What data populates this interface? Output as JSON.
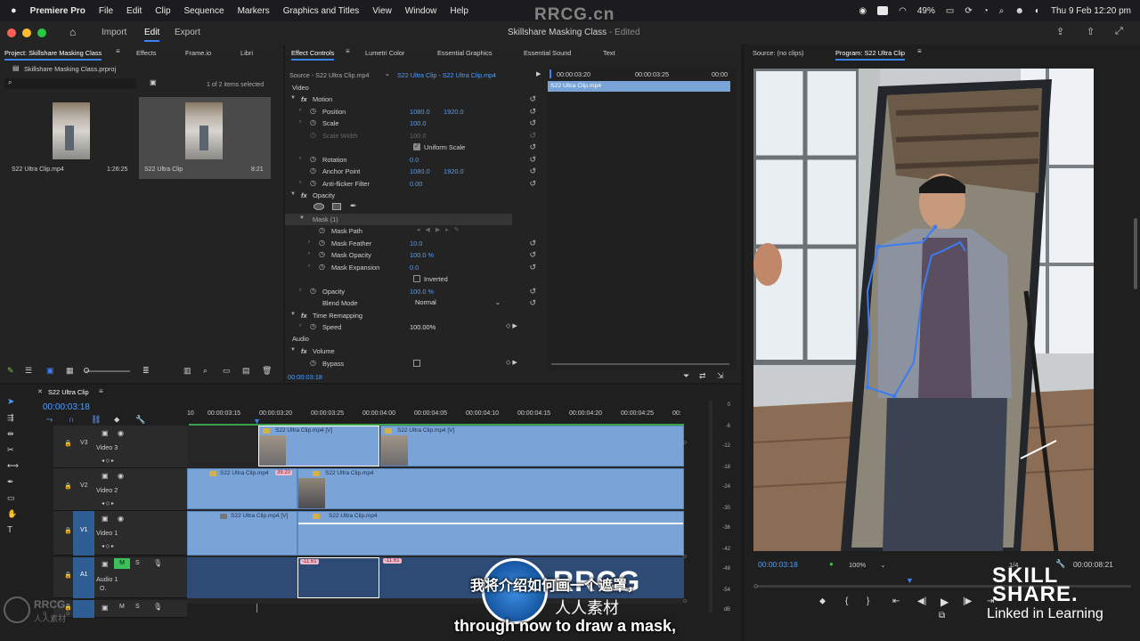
{
  "menubar": {
    "items": [
      "Premiere Pro",
      "File",
      "Edit",
      "Clip",
      "Sequence",
      "Markers",
      "Graphics and Titles",
      "View",
      "Window",
      "Help"
    ],
    "battery": "49%",
    "datetime": "Thu 9 Feb  12:20 pm"
  },
  "watermark": {
    "top": "RRCG.cn"
  },
  "titlebar": {
    "workspaces": [
      "Import",
      "Edit",
      "Export"
    ],
    "document_title": "Skillshare Masking Class",
    "status": "- Edited"
  },
  "project": {
    "tabs": [
      "Project: Skillshare Masking Class",
      "Effects",
      "Frame.io",
      "Libri"
    ],
    "file": "Skillshare Masking Class.prproj",
    "selection_info": "1 of 2 items selected",
    "items": [
      {
        "name": "S22 Ultra Clip.mp4",
        "duration": "1:26:25"
      },
      {
        "name": "S22 Ultra Clip",
        "duration": "8:21"
      }
    ]
  },
  "effect_controls": {
    "tabs": [
      "Effect Controls",
      "Lumetri Color",
      "Essential Graphics",
      "Essential Sound",
      "Text"
    ],
    "source_label": "Source - S22 Ultra Clip.mp4",
    "sequence_clip": "S22 Ultra Clip - S22 Ultra Clip.mp4",
    "sections": {
      "video": "Video",
      "audio": "Audio"
    },
    "rows": [
      {
        "label": "Motion",
        "v1": "",
        "v2": ""
      },
      {
        "label": "Position",
        "v1": "1080.0",
        "v2": "1920.0"
      },
      {
        "label": "Scale",
        "v1": "100.0",
        "v2": ""
      },
      {
        "label": "Scale Width",
        "v1": "100.0",
        "v2": ""
      },
      {
        "label": "Uniform Scale",
        "v1": "",
        "v2": ""
      },
      {
        "label": "Rotation",
        "v1": "0.0",
        "v2": ""
      },
      {
        "label": "Anchor Point",
        "v1": "1080.0",
        "v2": "1920.0"
      },
      {
        "label": "Anti-flicker Filter",
        "v1": "0.00",
        "v2": ""
      },
      {
        "label": "Opacity",
        "v1": "",
        "v2": ""
      },
      {
        "label": "Mask (1)",
        "v1": "",
        "v2": ""
      },
      {
        "label": "Mask Path",
        "v1": "",
        "v2": ""
      },
      {
        "label": "Mask Feather",
        "v1": "10.0",
        "v2": ""
      },
      {
        "label": "Mask Opacity",
        "v1": "100.0 %",
        "v2": ""
      },
      {
        "label": "Mask Expansion",
        "v1": "0.0",
        "v2": ""
      },
      {
        "label": "Inverted",
        "v1": "",
        "v2": ""
      },
      {
        "label": "Opacity",
        "v1": "100.0 %",
        "v2": ""
      },
      {
        "label": "Blend Mode",
        "v1": "Normal",
        "v2": ""
      },
      {
        "label": "Time Remapping",
        "v1": "",
        "v2": ""
      },
      {
        "label": "Speed",
        "v1": "100.00%",
        "v2": ""
      },
      {
        "label": "Volume",
        "v1": "",
        "v2": ""
      },
      {
        "label": "Bypass",
        "v1": "",
        "v2": ""
      }
    ],
    "timeline_times": [
      "00:00:03:20",
      "00:00:03:25",
      "00:00"
    ],
    "timeline_clip": "S22 Ultra Clip.mp4",
    "current_time": "00:00:03:18"
  },
  "program": {
    "source_tab": "Source: (no clips)",
    "program_tab": "Program: S22 Ultra Clip",
    "timecode": "00:00:03:18",
    "zoom": "100%",
    "quality": "1/4",
    "duration": "00:00:08:21"
  },
  "timeline": {
    "sequence_name": "S22 Ultra Clip",
    "timecode": "00:00:03:18",
    "ruler": [
      "10",
      "00:00:03:15",
      "00:00:03:20",
      "00:00:03:25",
      "00:00:04:00",
      "00:00:04:05",
      "00:00:04:10",
      "00:00:04:15",
      "00:00:04:20",
      "00:00:04:25",
      "00:"
    ],
    "tracks": [
      {
        "id": "V3",
        "name": "Video 3"
      },
      {
        "id": "V2",
        "name": "Video 2"
      },
      {
        "id": "V1",
        "name": "Video 1"
      },
      {
        "id": "A1",
        "name": "Audio 1"
      },
      {
        "id": "A2",
        "name": ""
      }
    ],
    "clips": {
      "v3a": "S22 Ultra Clip.mp4 [V]",
      "v3b": "S22 Ultra Clip.mp4 [V]",
      "v2a": "S22 Ultra Clip.mp4",
      "v2b": "S22 Ultra Clip.mp4",
      "v1a": "S22 Ultra Clip.mp4 [V]",
      "v1b": "S22 Ultra Clip.mp4",
      "a1a": "-11.61",
      "a1b": "-11.61",
      "v2_marker": "39.20"
    },
    "meter_ticks": [
      "0",
      "-6",
      "-12",
      "-18",
      "-24",
      "-30",
      "-36",
      "-42",
      "-48",
      "-54",
      "dB"
    ]
  },
  "subtitles": {
    "chinese": "我将介绍如何画一个遮罩，",
    "english": "through now to draw a mask,"
  },
  "branding": {
    "skillshare_line1": "SKILL",
    "skillshare_line2": "SHARE.",
    "linkedin": "Linked in Learning",
    "rrcg": "RRCG",
    "rrcg_sub": "人人素材"
  },
  "colors": {
    "accent": "#3b82f6",
    "clip": "#7aa4d8",
    "timecode": "#4f9ef8"
  }
}
